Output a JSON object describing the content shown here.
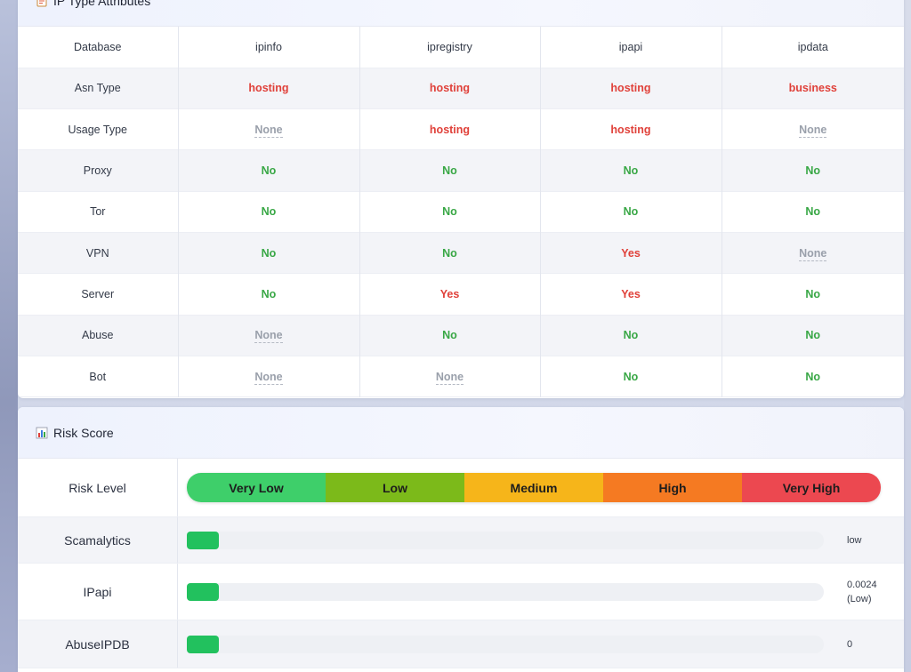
{
  "ip_attributes": {
    "title": "IP Type Attributes",
    "header": {
      "label": "Database",
      "sources": [
        "ipinfo",
        "ipregistry",
        "ipapi",
        "ipdata"
      ]
    },
    "rows": [
      {
        "label": "Asn Type",
        "values": [
          {
            "text": "hosting",
            "status": "red"
          },
          {
            "text": "hosting",
            "status": "red"
          },
          {
            "text": "hosting",
            "status": "red"
          },
          {
            "text": "business",
            "status": "red"
          }
        ]
      },
      {
        "label": "Usage Type",
        "values": [
          {
            "text": "None",
            "status": "none"
          },
          {
            "text": "hosting",
            "status": "red"
          },
          {
            "text": "hosting",
            "status": "red"
          },
          {
            "text": "None",
            "status": "none"
          }
        ]
      },
      {
        "label": "Proxy",
        "values": [
          {
            "text": "No",
            "status": "green"
          },
          {
            "text": "No",
            "status": "green"
          },
          {
            "text": "No",
            "status": "green"
          },
          {
            "text": "No",
            "status": "green"
          }
        ]
      },
      {
        "label": "Tor",
        "values": [
          {
            "text": "No",
            "status": "green"
          },
          {
            "text": "No",
            "status": "green"
          },
          {
            "text": "No",
            "status": "green"
          },
          {
            "text": "No",
            "status": "green"
          }
        ]
      },
      {
        "label": "VPN",
        "values": [
          {
            "text": "No",
            "status": "green"
          },
          {
            "text": "No",
            "status": "green"
          },
          {
            "text": "Yes",
            "status": "red"
          },
          {
            "text": "None",
            "status": "none"
          }
        ]
      },
      {
        "label": "Server",
        "values": [
          {
            "text": "No",
            "status": "green"
          },
          {
            "text": "Yes",
            "status": "red"
          },
          {
            "text": "Yes",
            "status": "red"
          },
          {
            "text": "No",
            "status": "green"
          }
        ]
      },
      {
        "label": "Abuse",
        "values": [
          {
            "text": "None",
            "status": "none"
          },
          {
            "text": "No",
            "status": "green"
          },
          {
            "text": "No",
            "status": "green"
          },
          {
            "text": "No",
            "status": "green"
          }
        ]
      },
      {
        "label": "Bot",
        "values": [
          {
            "text": "None",
            "status": "none"
          },
          {
            "text": "None",
            "status": "none"
          },
          {
            "text": "No",
            "status": "green"
          },
          {
            "text": "No",
            "status": "green"
          }
        ]
      }
    ]
  },
  "risk_score": {
    "title": "Risk Score",
    "level_label": "Risk Level",
    "levels": [
      {
        "text": "Very Low",
        "color": "#3ecf6a"
      },
      {
        "text": "Low",
        "color": "#7cba1a"
      },
      {
        "text": "Medium",
        "color": "#f6b51a"
      },
      {
        "text": "High",
        "color": "#f57a22"
      },
      {
        "text": "Very High",
        "color": "#ec4850"
      }
    ],
    "scores": [
      {
        "label": "Scamalytics",
        "text_line1": "low",
        "text_line2": ""
      },
      {
        "label": "IPapi",
        "text_line1": "0.0024",
        "text_line2": "(Low)"
      },
      {
        "label": "AbuseIPDB",
        "text_line1": "0",
        "text_line2": ""
      }
    ]
  },
  "colors": {
    "red": "#e0413a",
    "green": "#38a745",
    "none": "#9aa0ab",
    "fill": "#22c15e"
  },
  "icons": {
    "ip_header": "document-icon",
    "risk_header": "bar-chart-icon"
  }
}
